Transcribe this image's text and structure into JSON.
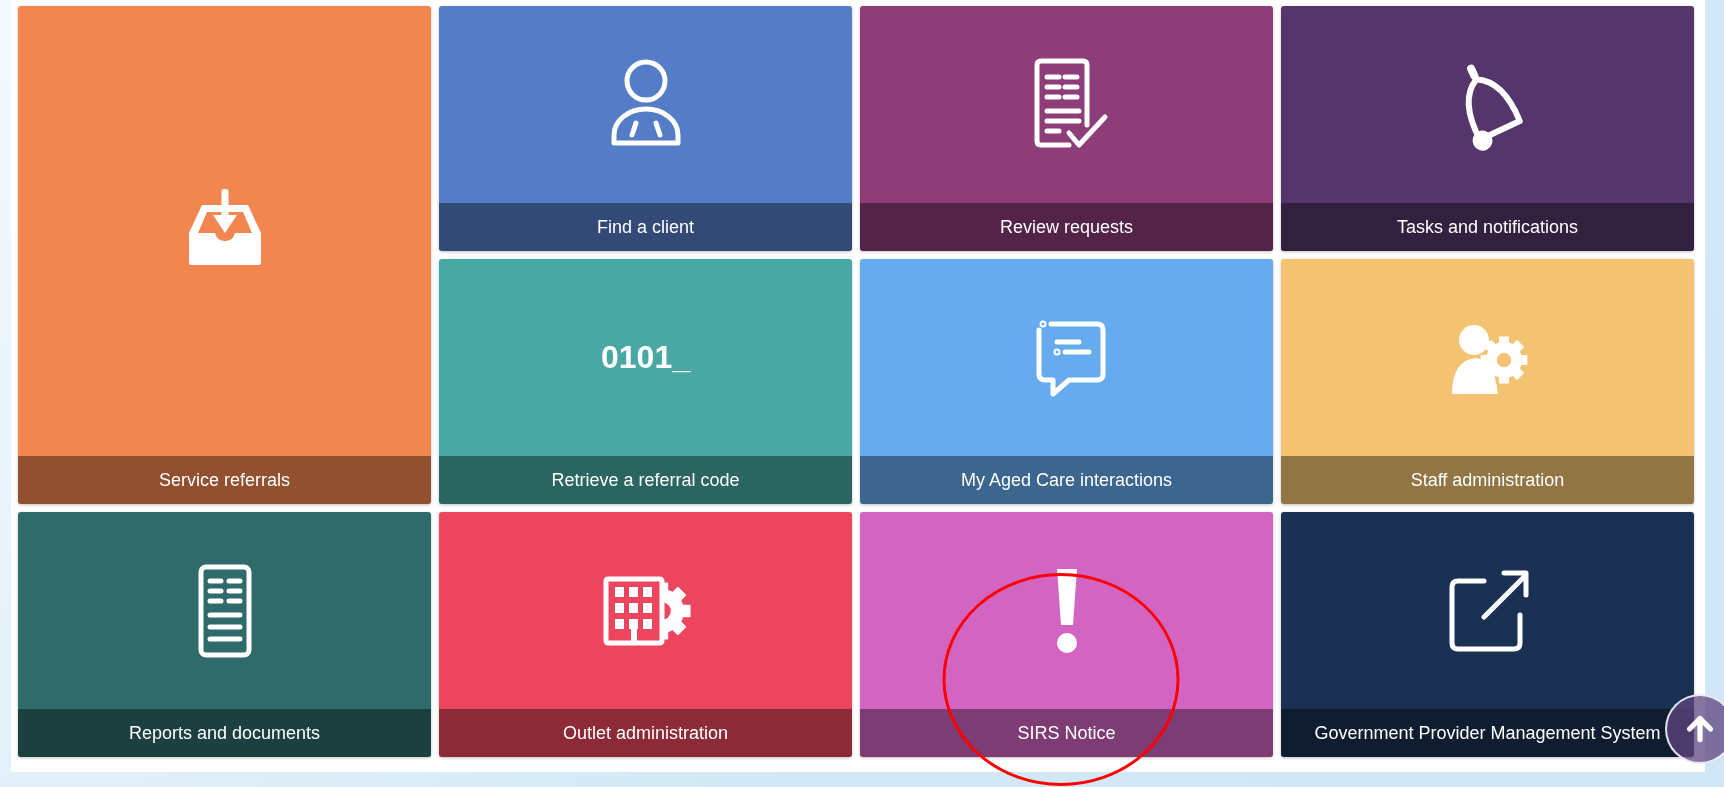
{
  "tiles": [
    {
      "label": "Service referrals",
      "kind": "inbox",
      "color": "#f28650",
      "tall": true,
      "circled": false
    },
    {
      "label": "Find a client",
      "kind": "person",
      "color": "#557cc7",
      "tall": false,
      "circled": false
    },
    {
      "label": "Review requests",
      "kind": "document-check",
      "color": "#8d3d78",
      "tall": false,
      "circled": false
    },
    {
      "label": "Tasks and notifications",
      "kind": "bell",
      "color": "#54366a",
      "tall": false,
      "circled": false
    },
    {
      "label": "Retrieve a referral code",
      "kind": "code",
      "icon_text": "0101_",
      "color": "#49a8a4",
      "tall": false,
      "circled": false
    },
    {
      "label": "My Aged Care interactions",
      "kind": "chat",
      "color": "#66abee",
      "tall": false,
      "circled": false
    },
    {
      "label": "Staff administration",
      "kind": "staff-gear",
      "color": "#f3c372",
      "tall": false,
      "circled": false
    },
    {
      "label": "Reports and documents",
      "kind": "document",
      "color": "#2f6b69",
      "tall": false,
      "circled": false
    },
    {
      "label": "Outlet administration",
      "kind": "building-gear",
      "color": "#ec465e",
      "tall": false,
      "circled": false
    },
    {
      "label": "SIRS Notice",
      "kind": "exclamation",
      "color": "#d265c2",
      "tall": false,
      "circled": true
    },
    {
      "label": "Government Provider Management System",
      "kind": "external-link",
      "color": "#1b3153",
      "tall": false,
      "circled": false
    }
  ],
  "scroll_top_button": {
    "kind": "arrow-up"
  }
}
